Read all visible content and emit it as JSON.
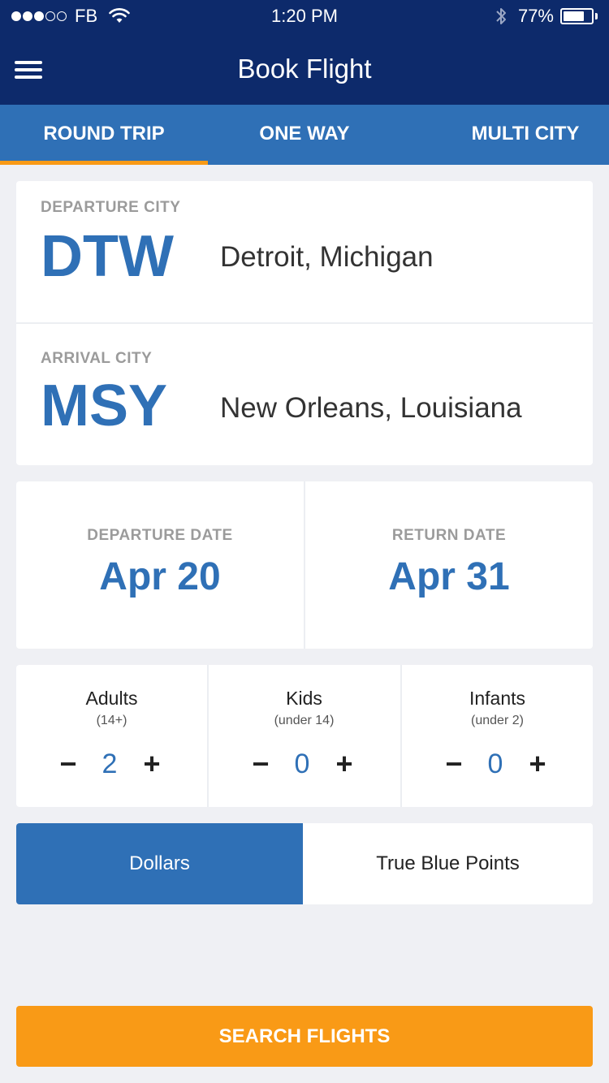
{
  "status_bar": {
    "carrier": "FB",
    "time": "1:20 PM",
    "battery_percent": "77%",
    "battery_level": 0.77,
    "signal_bars_filled": 3,
    "signal_bars_total": 5,
    "icons": [
      "wifi-icon",
      "bluetooth-icon",
      "battery-icon"
    ]
  },
  "header": {
    "title": "Book Flight",
    "menu_icon": "hamburger-menu-icon"
  },
  "tabs": [
    {
      "label": "ROUND TRIP",
      "active": true
    },
    {
      "label": "ONE WAY",
      "active": false
    },
    {
      "label": "MULTI CITY",
      "active": false
    }
  ],
  "departure": {
    "label": "DEPARTURE CITY",
    "code": "DTW",
    "city": "Detroit, Michigan"
  },
  "arrival": {
    "label": "ARRIVAL CITY",
    "code": "MSY",
    "city": "New Orleans, Louisiana"
  },
  "dates": {
    "departure_label": "DEPARTURE DATE",
    "departure_value": "Apr 20",
    "return_label": "RETURN DATE",
    "return_value": "Apr 31"
  },
  "passengers": [
    {
      "title": "Adults",
      "sub": "(14+)",
      "count": "2",
      "minus": "−",
      "plus": "+"
    },
    {
      "title": "Kids",
      "sub": "(under 14)",
      "count": "0",
      "minus": "−",
      "plus": "+"
    },
    {
      "title": "Infants",
      "sub": "(under 2)",
      "count": "0",
      "minus": "−",
      "plus": "+"
    }
  ],
  "currency": {
    "options": [
      "Dollars",
      "True Blue Points"
    ],
    "selected": "Dollars"
  },
  "search_button": "SEARCH FLIGHTS",
  "colors": {
    "header_bg": "#0d2a6b",
    "tab_bg": "#2f70b6",
    "accent": "#f99a16",
    "primary_blue": "#2f70b6",
    "background": "#eff0f4"
  }
}
